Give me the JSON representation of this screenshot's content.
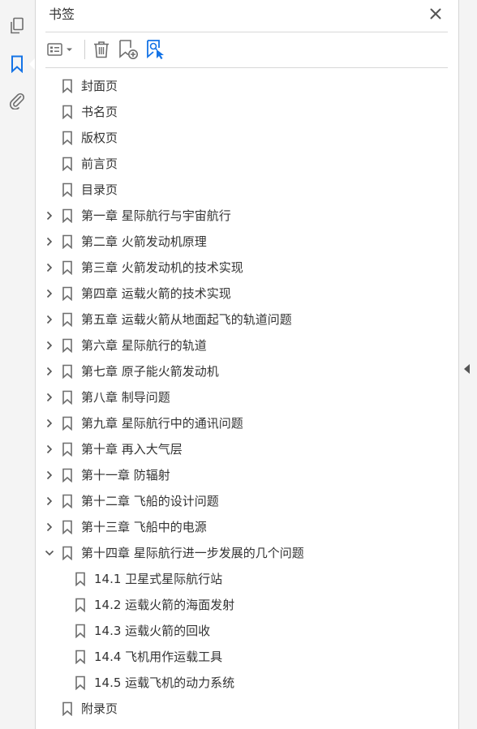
{
  "panel": {
    "title": "书签",
    "close_icon": "close-icon"
  },
  "rail": {
    "items": [
      {
        "icon": "pages-icon"
      },
      {
        "icon": "bookmark-icon",
        "active": true
      },
      {
        "icon": "attachment-icon"
      }
    ]
  },
  "toolbar": {
    "items": [
      {
        "icon": "options-menu-icon"
      },
      {
        "icon": "delete-icon"
      },
      {
        "icon": "new-bookmark-icon"
      },
      {
        "icon": "find-current-bookmark-icon"
      }
    ]
  },
  "colors": {
    "accent": "#1473e6",
    "icon_gray": "#6e6e6e"
  },
  "bookmarks": [
    {
      "label": "封面页",
      "level": 0,
      "expandable": false
    },
    {
      "label": "书名页",
      "level": 0,
      "expandable": false
    },
    {
      "label": "版权页",
      "level": 0,
      "expandable": false
    },
    {
      "label": "前言页",
      "level": 0,
      "expandable": false
    },
    {
      "label": "目录页",
      "level": 0,
      "expandable": false
    },
    {
      "label": "第一章 星际航行与宇宙航行",
      "level": 0,
      "expandable": true,
      "expanded": false
    },
    {
      "label": "第二章 火箭发动机原理",
      "level": 0,
      "expandable": true,
      "expanded": false
    },
    {
      "label": "第三章 火箭发动机的技术实现",
      "level": 0,
      "expandable": true,
      "expanded": false
    },
    {
      "label": "第四章 运载火箭的技术实现",
      "level": 0,
      "expandable": true,
      "expanded": false
    },
    {
      "label": "第五章 运载火箭从地面起飞的轨道问题",
      "level": 0,
      "expandable": true,
      "expanded": false
    },
    {
      "label": "第六章 星际航行的轨道",
      "level": 0,
      "expandable": true,
      "expanded": false
    },
    {
      "label": "第七章 原子能火箭发动机",
      "level": 0,
      "expandable": true,
      "expanded": false
    },
    {
      "label": "第八章 制导问题",
      "level": 0,
      "expandable": true,
      "expanded": false
    },
    {
      "label": "第九章 星际航行中的通讯问题",
      "level": 0,
      "expandable": true,
      "expanded": false
    },
    {
      "label": "第十章 再入大气层",
      "level": 0,
      "expandable": true,
      "expanded": false
    },
    {
      "label": "第十一章 防辐射",
      "level": 0,
      "expandable": true,
      "expanded": false
    },
    {
      "label": "第十二章 飞船的设计问题",
      "level": 0,
      "expandable": true,
      "expanded": false
    },
    {
      "label": "第十三章 飞船中的电源",
      "level": 0,
      "expandable": true,
      "expanded": false
    },
    {
      "label": "第十四章 星际航行进一步发展的几个问题",
      "level": 0,
      "expandable": true,
      "expanded": true
    },
    {
      "label": "14.1 卫星式星际航行站",
      "level": 1,
      "expandable": false
    },
    {
      "label": "14.2 运载火箭的海面发射",
      "level": 1,
      "expandable": false
    },
    {
      "label": "14.3 运载火箭的回收",
      "level": 1,
      "expandable": false
    },
    {
      "label": "14.4 飞机用作运载工具",
      "level": 1,
      "expandable": false
    },
    {
      "label": "14.5 运载飞机的动力系统",
      "level": 1,
      "expandable": false
    },
    {
      "label": "附录页",
      "level": 0,
      "expandable": false
    }
  ]
}
